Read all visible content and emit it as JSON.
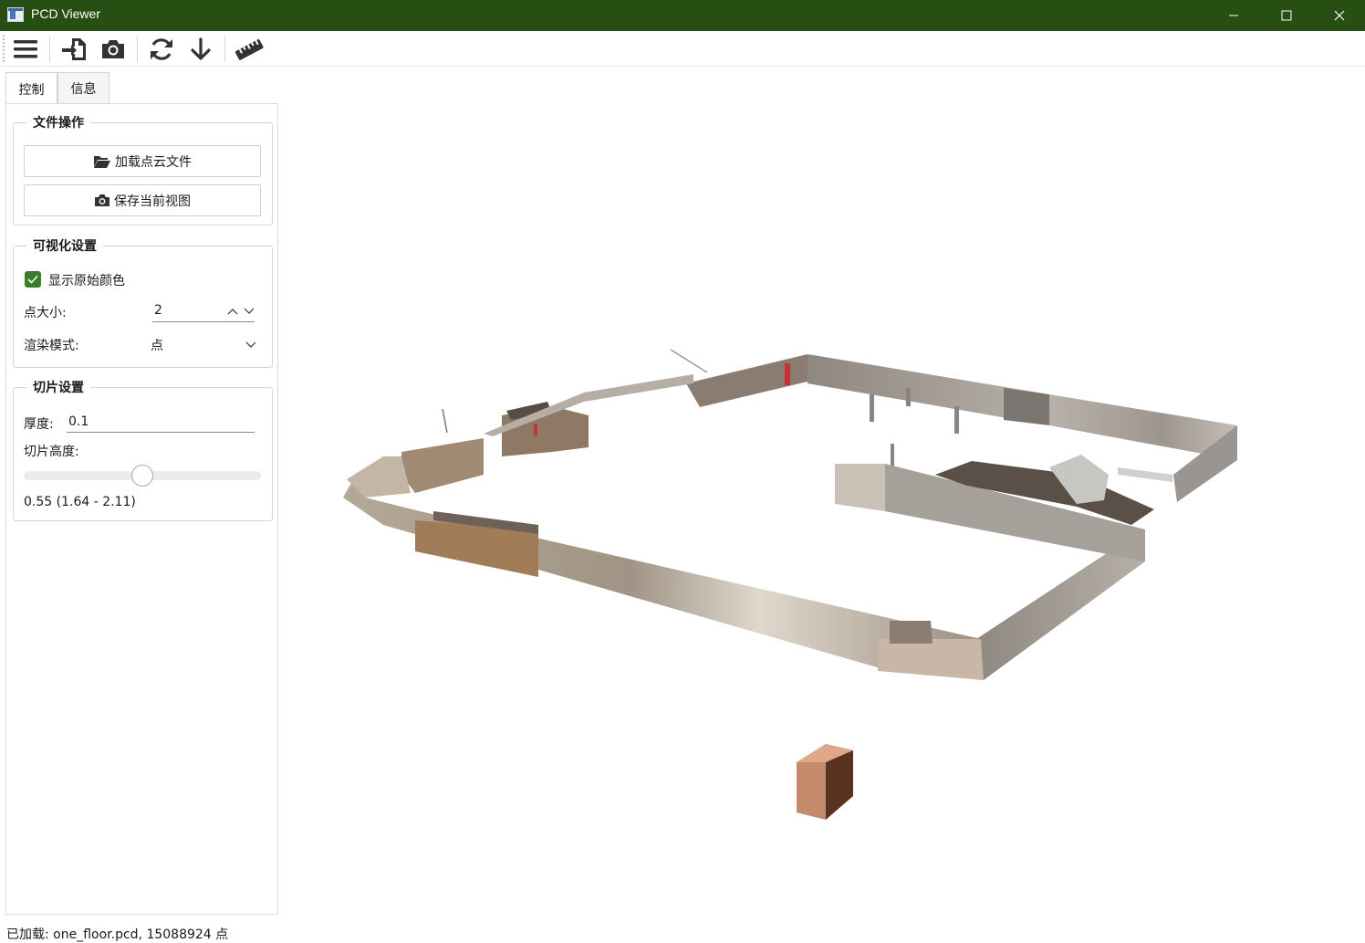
{
  "window": {
    "title": "PCD Viewer"
  },
  "toolbar": {
    "buttons": [
      {
        "icon": "menu-icon",
        "label": ""
      },
      {
        "icon": "import-file-icon",
        "label": ""
      },
      {
        "icon": "camera-icon",
        "label": ""
      },
      {
        "icon": "refresh-icon",
        "label": ""
      },
      {
        "icon": "arrow-down-icon",
        "label": ""
      },
      {
        "icon": "ruler-icon",
        "label": ""
      }
    ]
  },
  "tabs": [
    {
      "label": "控制",
      "active": true
    },
    {
      "label": "信息",
      "active": false
    }
  ],
  "file_ops": {
    "title": "文件操作",
    "load_label": "加载点云文件",
    "save_view_label": "保存当前视图"
  },
  "visual": {
    "title": "可视化设置",
    "show_color_label": "显示原始颜色",
    "show_color_checked": true,
    "point_size_label": "点大小:",
    "point_size_value": "2",
    "render_mode_label": "渲染模式:",
    "render_mode_value": "点"
  },
  "slice": {
    "title": "切片设置",
    "thickness_label": "厚度:",
    "thickness_value": "0.1",
    "height_label": "切片高度:",
    "height_fraction": 0.5,
    "height_readout": "0.55 (1.64 - 2.11)"
  },
  "status": {
    "text": "已加载: one_floor.pcd, 15088924 点"
  },
  "colors": {
    "titlebar": "#274e13",
    "accent": "#3a7d2c"
  }
}
